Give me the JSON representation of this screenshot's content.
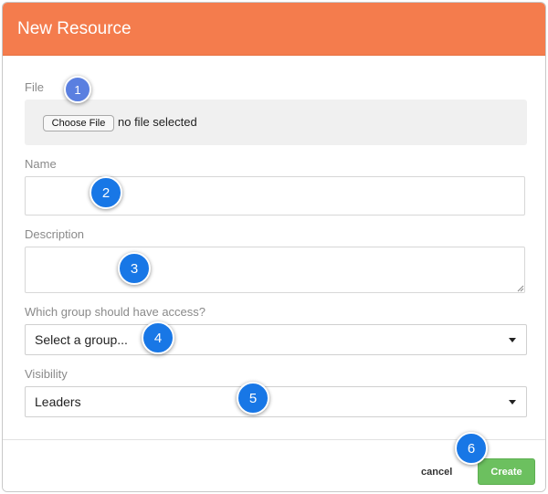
{
  "dialog": {
    "title": "New Resource"
  },
  "form": {
    "file": {
      "label": "File",
      "choose_button": "Choose File",
      "status": "no file selected"
    },
    "name": {
      "label": "Name",
      "value": ""
    },
    "description": {
      "label": "Description",
      "value": ""
    },
    "group": {
      "label": "Which group should have access?",
      "selected": "Select a group..."
    },
    "visibility": {
      "label": "Visibility",
      "selected": "Leaders"
    }
  },
  "footer": {
    "cancel_label": "cancel",
    "create_label": "Create"
  },
  "step_markers": [
    "1",
    "2",
    "3",
    "4",
    "5",
    "6"
  ],
  "colors": {
    "header": "#f47c4d",
    "create_button": "#6cc05f",
    "step_marker": "#1877e6"
  }
}
